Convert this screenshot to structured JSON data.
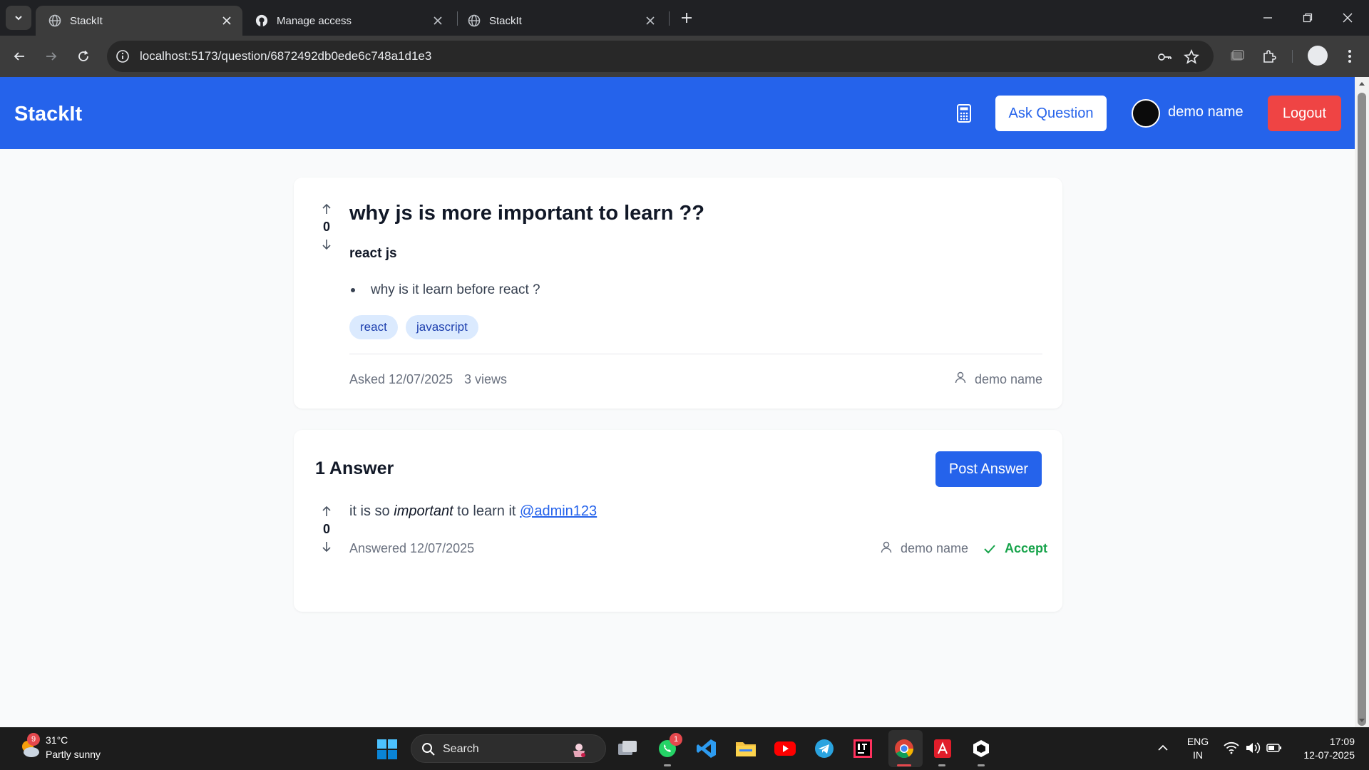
{
  "browser": {
    "tabs": [
      {
        "title": "StackIt",
        "active": true
      },
      {
        "title": "Manage access",
        "active": false
      },
      {
        "title": "StackIt",
        "active": false
      }
    ],
    "url": "localhost:5173/question/6872492db0ede6c748a1d1e3"
  },
  "header": {
    "brand": "StackIt",
    "ask_button": "Ask Question",
    "user_name": "demo name",
    "logout_button": "Logout",
    "brand_color": "#2563eb"
  },
  "question": {
    "votes": "0",
    "title": "why js is more important to learn ??",
    "subtitle": "react js",
    "bullet": "why is it learn before react ?",
    "tags": [
      "react",
      "javascript"
    ],
    "asked": "Asked 12/07/2025",
    "views": "3 views",
    "author": "demo name"
  },
  "answers": {
    "heading": "1 Answer",
    "post_button": "Post Answer",
    "items": [
      {
        "votes": "0",
        "text_before": "it is so ",
        "text_em": "important",
        "text_after": " to learn it ",
        "mention": "@admin123",
        "answered": "Answered 12/07/2025",
        "author": "demo name",
        "accept_label": "Accept"
      }
    ]
  },
  "taskbar": {
    "weather_badge": "9",
    "temperature": "31°C",
    "weather": "Partly sunny",
    "search_label": "Search",
    "whatsapp_badge": "1",
    "lang_top": "ENG",
    "lang_bottom": "IN",
    "time": "17:09",
    "date": "12-07-2025"
  }
}
